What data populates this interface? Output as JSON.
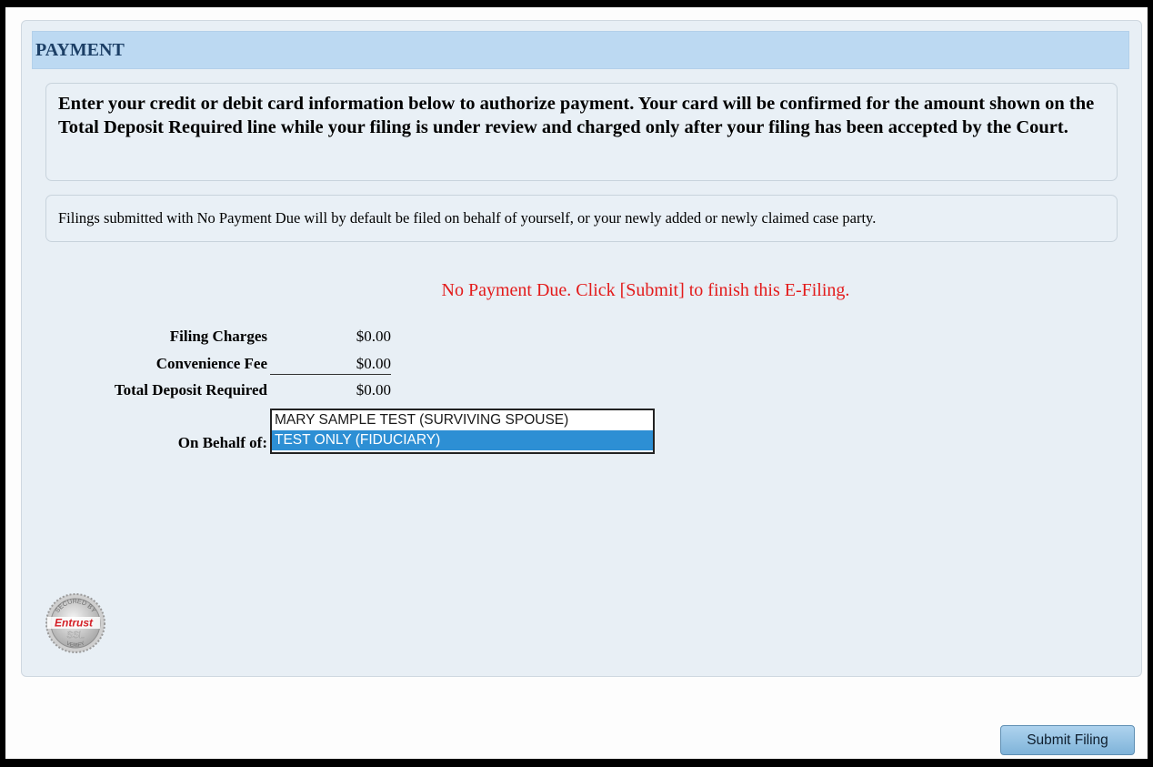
{
  "section": {
    "title": "PAYMENT"
  },
  "notice": {
    "text": "Enter your credit or debit card information below to authorize payment. Your card will be confirmed for the amount shown on the Total Deposit Required line while your filing is under review and charged only after your filing has been accepted by the Court."
  },
  "info": {
    "text": "Filings submitted with No Payment Due will by default be filed on behalf of yourself, or your newly added or newly claimed case party."
  },
  "status": {
    "message": "No Payment Due. Click [Submit] to finish this E-Filing.",
    "color": "#e31b1b"
  },
  "fees": {
    "filing_charges_label": "Filing Charges",
    "filing_charges_value": "$0.00",
    "convenience_fee_label": "Convenience Fee",
    "convenience_fee_value": "$0.00",
    "total_label": "Total Deposit Required",
    "total_value": "$0.00"
  },
  "behalf": {
    "label": "On Behalf of:",
    "options": [
      "MARY SAMPLE TEST (SURVIVING SPOUSE)",
      "TEST ONLY (FIDUCIARY)"
    ],
    "selected": "TEST ONLY (FIDUCIARY)"
  },
  "seal": {
    "top_text": "SECURED BY",
    "brand": "Entrust",
    "sub": "SSL",
    "bottom_text": "VERIFY",
    "brand_color": "#d42027"
  },
  "actions": {
    "submit_label": "Submit Filing"
  }
}
